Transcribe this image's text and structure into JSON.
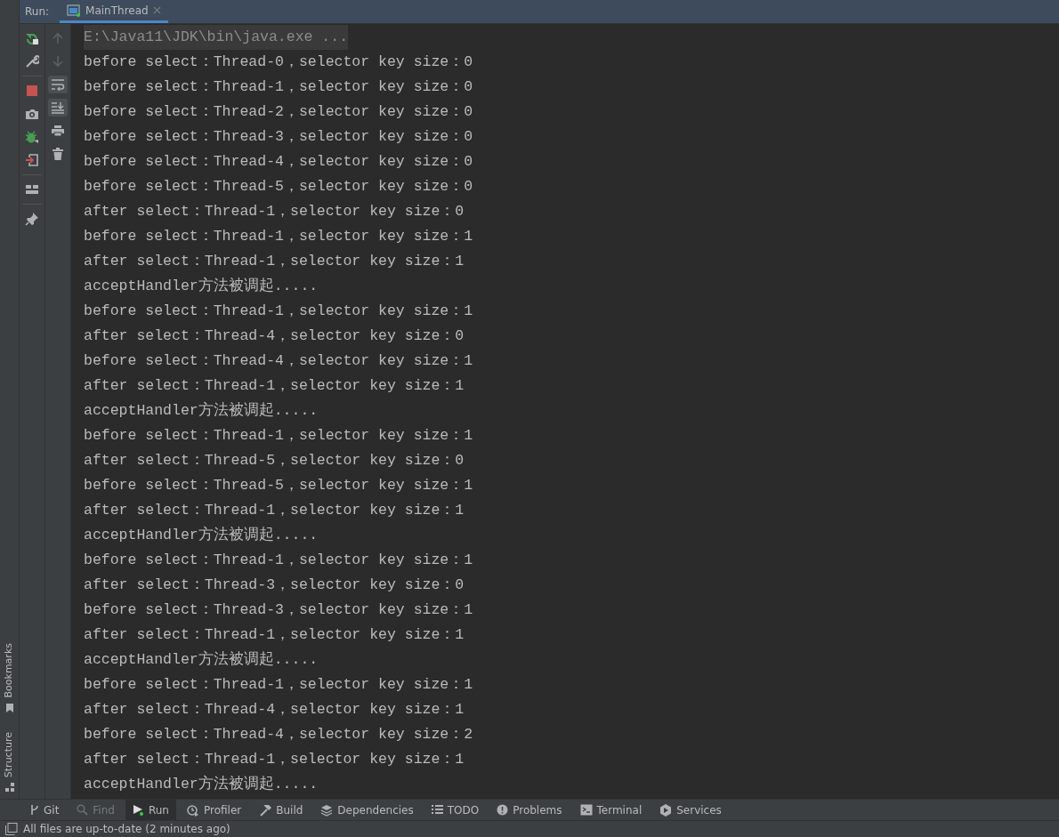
{
  "run_header": {
    "label": "Run:",
    "tabs": [
      {
        "label": "MainThread",
        "selected": true
      }
    ]
  },
  "side_stripe": [
    {
      "label": "Bookmarks",
      "kind": "bookmarks"
    },
    {
      "label": "Structure",
      "kind": "structure"
    }
  ],
  "run_toolbar": [
    {
      "kind": "rerun"
    },
    {
      "kind": "settings"
    },
    {
      "kind": "divider"
    },
    {
      "kind": "stop"
    },
    {
      "kind": "camera"
    },
    {
      "kind": "debug"
    },
    {
      "kind": "exit"
    },
    {
      "kind": "divider"
    },
    {
      "kind": "layout"
    },
    {
      "kind": "divider"
    },
    {
      "kind": "pin"
    }
  ],
  "console_toolbar": [
    {
      "kind": "up",
      "disabled": true,
      "on": false
    },
    {
      "kind": "down",
      "disabled": true,
      "on": false
    },
    {
      "kind": "wrap",
      "disabled": false,
      "on": true
    },
    {
      "kind": "scroll-end",
      "disabled": false,
      "on": true
    },
    {
      "kind": "print",
      "disabled": false,
      "on": false
    },
    {
      "kind": "trash",
      "disabled": false,
      "on": false
    }
  ],
  "console_lines": [
    {
      "kind": "command",
      "text": "E:\\Java11\\JDK\\bin\\java.exe ..."
    },
    {
      "kind": "output",
      "text": "before select：Thread-0，selector key size：0"
    },
    {
      "kind": "output",
      "text": "before select：Thread-1，selector key size：0"
    },
    {
      "kind": "output",
      "text": "before select：Thread-2，selector key size：0"
    },
    {
      "kind": "output",
      "text": "before select：Thread-3，selector key size：0"
    },
    {
      "kind": "output",
      "text": "before select：Thread-4，selector key size：0"
    },
    {
      "kind": "output",
      "text": "before select：Thread-5，selector key size：0"
    },
    {
      "kind": "output",
      "text": "after select：Thread-1，selector key size：0"
    },
    {
      "kind": "output",
      "text": "before select：Thread-1，selector key size：1"
    },
    {
      "kind": "output",
      "text": "after select：Thread-1，selector key size：1"
    },
    {
      "kind": "output",
      "text": "acceptHandler方法被调起....."
    },
    {
      "kind": "output",
      "text": "before select：Thread-1，selector key size：1"
    },
    {
      "kind": "output",
      "text": "after select：Thread-4，selector key size：0"
    },
    {
      "kind": "output",
      "text": "before select：Thread-4，selector key size：1"
    },
    {
      "kind": "output",
      "text": "after select：Thread-1，selector key size：1"
    },
    {
      "kind": "output",
      "text": "acceptHandler方法被调起....."
    },
    {
      "kind": "output",
      "text": "before select：Thread-1，selector key size：1"
    },
    {
      "kind": "output",
      "text": "after select：Thread-5，selector key size：0"
    },
    {
      "kind": "output",
      "text": "before select：Thread-5，selector key size：1"
    },
    {
      "kind": "output",
      "text": "after select：Thread-1，selector key size：1"
    },
    {
      "kind": "output",
      "text": "acceptHandler方法被调起....."
    },
    {
      "kind": "output",
      "text": "before select：Thread-1，selector key size：1"
    },
    {
      "kind": "output",
      "text": "after select：Thread-3，selector key size：0"
    },
    {
      "kind": "output",
      "text": "before select：Thread-3，selector key size：1"
    },
    {
      "kind": "output",
      "text": "after select：Thread-1，selector key size：1"
    },
    {
      "kind": "output",
      "text": "acceptHandler方法被调起....."
    },
    {
      "kind": "output",
      "text": "before select：Thread-1，selector key size：1"
    },
    {
      "kind": "output",
      "text": "after select：Thread-4，selector key size：1"
    },
    {
      "kind": "output",
      "text": "before select：Thread-4，selector key size：2"
    },
    {
      "kind": "output",
      "text": "after select：Thread-1，selector key size：1"
    },
    {
      "kind": "output",
      "text": "acceptHandler方法被调起....."
    }
  ],
  "tool_tabs": [
    {
      "kind": "git",
      "label": "Git",
      "selected": false,
      "disabled": false
    },
    {
      "kind": "find",
      "label": "Find",
      "selected": false,
      "disabled": true
    },
    {
      "kind": "run",
      "label": "Run",
      "selected": true,
      "disabled": false
    },
    {
      "kind": "profiler",
      "label": "Profiler",
      "selected": false,
      "disabled": false
    },
    {
      "kind": "build",
      "label": "Build",
      "selected": false,
      "disabled": false
    },
    {
      "kind": "dependencies",
      "label": "Dependencies",
      "selected": false,
      "disabled": false
    },
    {
      "kind": "todo",
      "label": "TODO",
      "selected": false,
      "disabled": false
    },
    {
      "kind": "problems",
      "label": "Problems",
      "selected": false,
      "disabled": false
    },
    {
      "kind": "terminal",
      "label": "Terminal",
      "selected": false,
      "disabled": false
    },
    {
      "kind": "services",
      "label": "Services",
      "selected": false,
      "disabled": false
    }
  ],
  "status_bar": {
    "text": "All files are up-to-date (2 minutes ago)"
  }
}
